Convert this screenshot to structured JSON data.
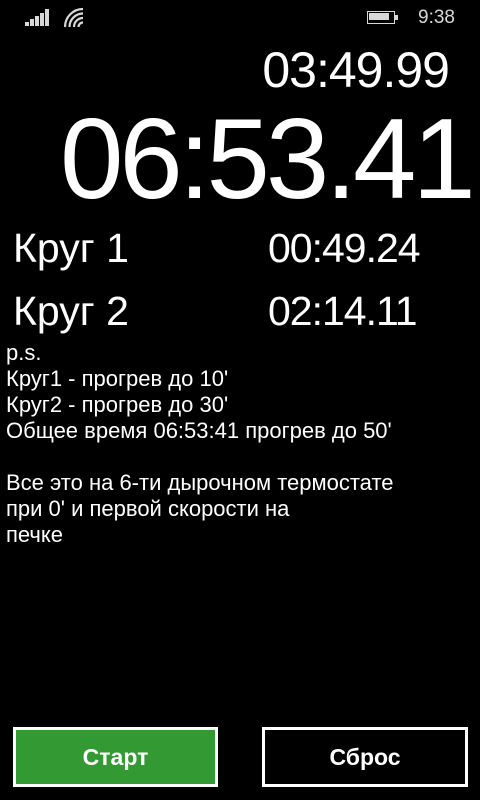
{
  "status_bar": {
    "time": "9:38",
    "signal_icon": "cellular-signal-icon",
    "wifi_icon": "wifi-icon",
    "battery_icon": "battery-icon",
    "battery_level": 0.85
  },
  "stopwatch": {
    "current_lap_time": "03:49.99",
    "total_time": "06:53.41",
    "laps": [
      {
        "label": "Круг 1",
        "time": "00:49.24"
      },
      {
        "label": "Круг 2",
        "time": "02:14.11"
      }
    ]
  },
  "notes": {
    "lines": [
      "p.s.",
      "Круг1 - прогрев до 10'",
      "Круг2 - прогрев до 30'",
      "Общее время 06:53:41 прогрев до 50'",
      "",
      "Все это на 6-ти дырочном термостате",
      "при 0' и первой скорости на",
      "печке"
    ]
  },
  "buttons": {
    "start_label": "Старт",
    "reset_label": "Сброс",
    "start_color": "#339933"
  }
}
